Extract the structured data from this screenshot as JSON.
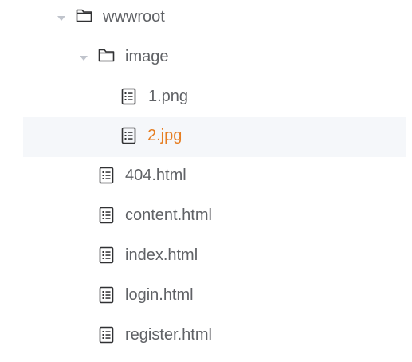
{
  "tree": {
    "folders": {
      "wwwroot": {
        "label": "wwwroot",
        "icon": "folder-open-icon",
        "expanded": true
      },
      "image": {
        "label": "image",
        "icon": "folder-open-icon",
        "expanded": true
      }
    },
    "image_files": [
      {
        "label": "1.png",
        "icon": "document-list-icon"
      },
      {
        "label": "2.jpg",
        "icon": "document-list-icon",
        "selected": true
      }
    ],
    "root_files": [
      {
        "label": "404.html",
        "icon": "document-list-icon"
      },
      {
        "label": "content.html",
        "icon": "document-list-icon"
      },
      {
        "label": "index.html",
        "icon": "document-list-icon"
      },
      {
        "label": "login.html",
        "icon": "document-list-icon"
      },
      {
        "label": "register.html",
        "icon": "document-list-icon"
      }
    ]
  },
  "colors": {
    "text": "#606266",
    "selected_text": "#e67e22",
    "selected_row_bg": "#f5f7fa",
    "icon": "#303133",
    "caret": "#c0c4cc"
  }
}
